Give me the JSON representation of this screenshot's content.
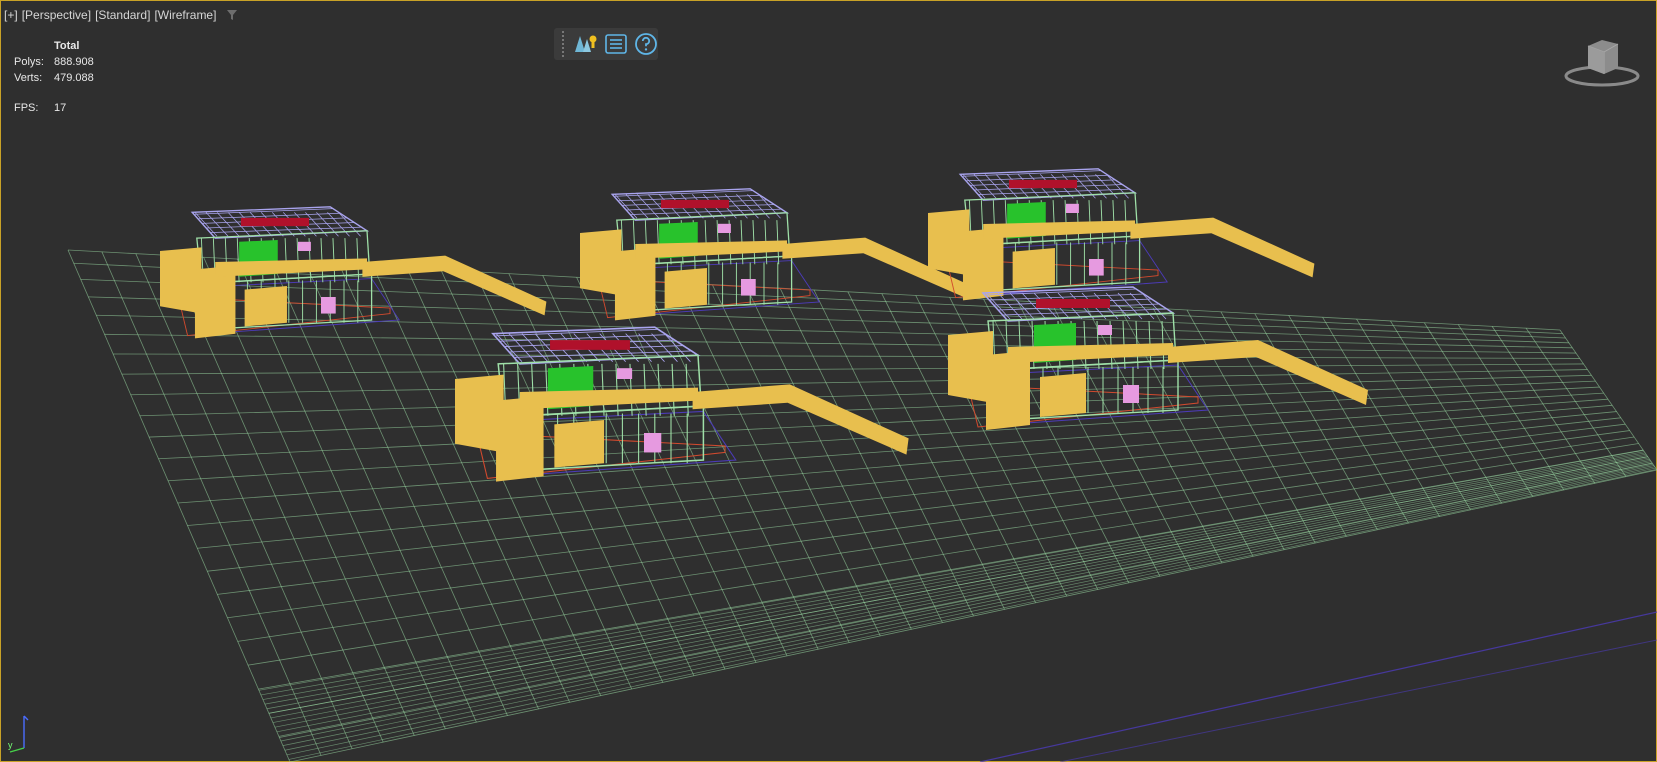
{
  "viewport": {
    "labels": [
      "[+]",
      "[Perspective]",
      "[Standard]",
      "[Wireframe]"
    ],
    "filter_icon": "filter-icon"
  },
  "stats": {
    "header": "Total",
    "polys_label": "Polys:",
    "polys_value": "888.908",
    "verts_label": "Verts:",
    "verts_value": "479.088",
    "fps_label": "FPS:",
    "fps_value": "17"
  },
  "toolbar": {
    "buttons": [
      {
        "name": "scene-explorer-icon"
      },
      {
        "name": "list-icon"
      },
      {
        "name": "help-icon"
      }
    ]
  },
  "axis": {
    "label": "y"
  },
  "colors": {
    "background": "#2f2f2f",
    "grid": "#9fe0a8",
    "wall": "#e8bf4e",
    "glass": "#28c22c",
    "roof": "#a9a4ee",
    "accent_red": "#b0112b",
    "pink": "#e69ae0",
    "outline": "#4c3bb8"
  }
}
